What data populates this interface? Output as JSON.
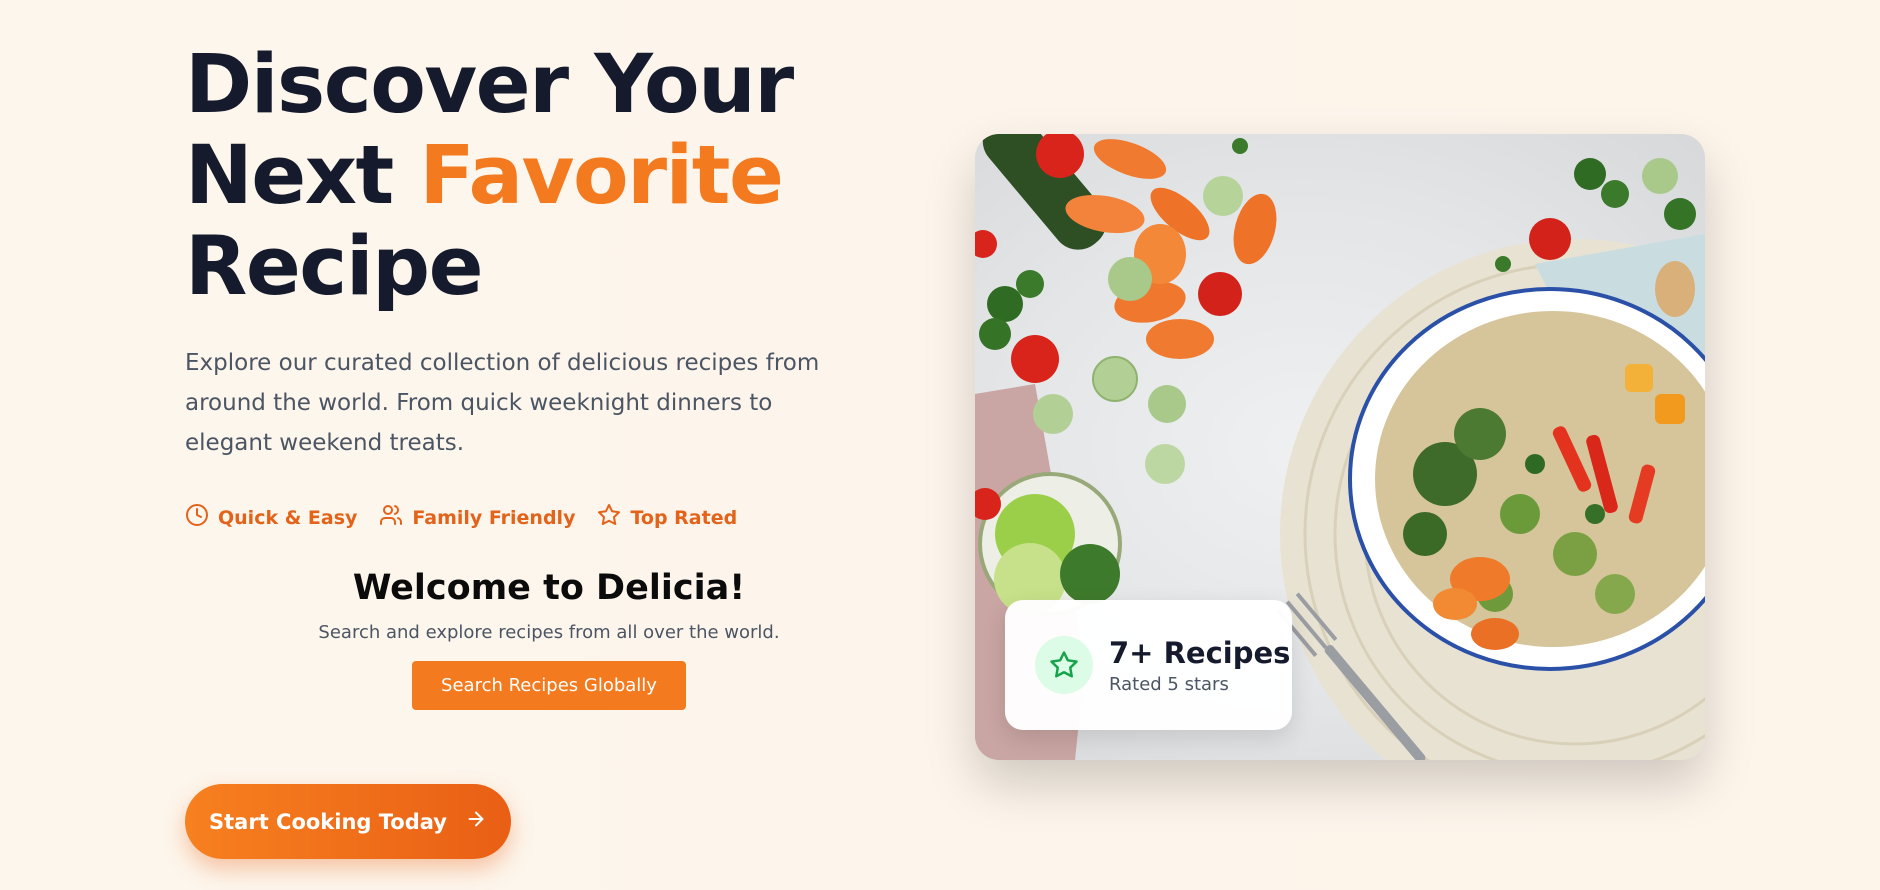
{
  "hero": {
    "title_line1": "Discover Your",
    "title_line2_prefix": "Next",
    "title_line2_accent": "Favorite",
    "title_line3": "Recipe",
    "subtitle": "Explore our curated collection of delicious recipes from around the world. From quick weeknight dinners to elegant weekend treats."
  },
  "features": [
    {
      "label": "Quick & Easy",
      "icon": "clock-icon"
    },
    {
      "label": "Family Friendly",
      "icon": "users-icon"
    },
    {
      "label": "Top Rated",
      "icon": "star-icon"
    }
  ],
  "welcome": {
    "heading": "Welcome to Delicia!",
    "text": "Search and explore recipes from all over the world.",
    "search_button": "Search Recipes Globally"
  },
  "cta": {
    "label": "Start Cooking Today",
    "icon": "arrow-right-icon"
  },
  "badge": {
    "title": "7+ Recipes",
    "subtitle": "Rated 5 stars",
    "icon": "star-icon"
  },
  "image": {
    "alt_description": "food-photo"
  },
  "colors": {
    "accent": "#f47a1f",
    "title": "#151b2d",
    "badge_icon_bg": "#dcfce7",
    "badge_icon": "#16a34a"
  }
}
